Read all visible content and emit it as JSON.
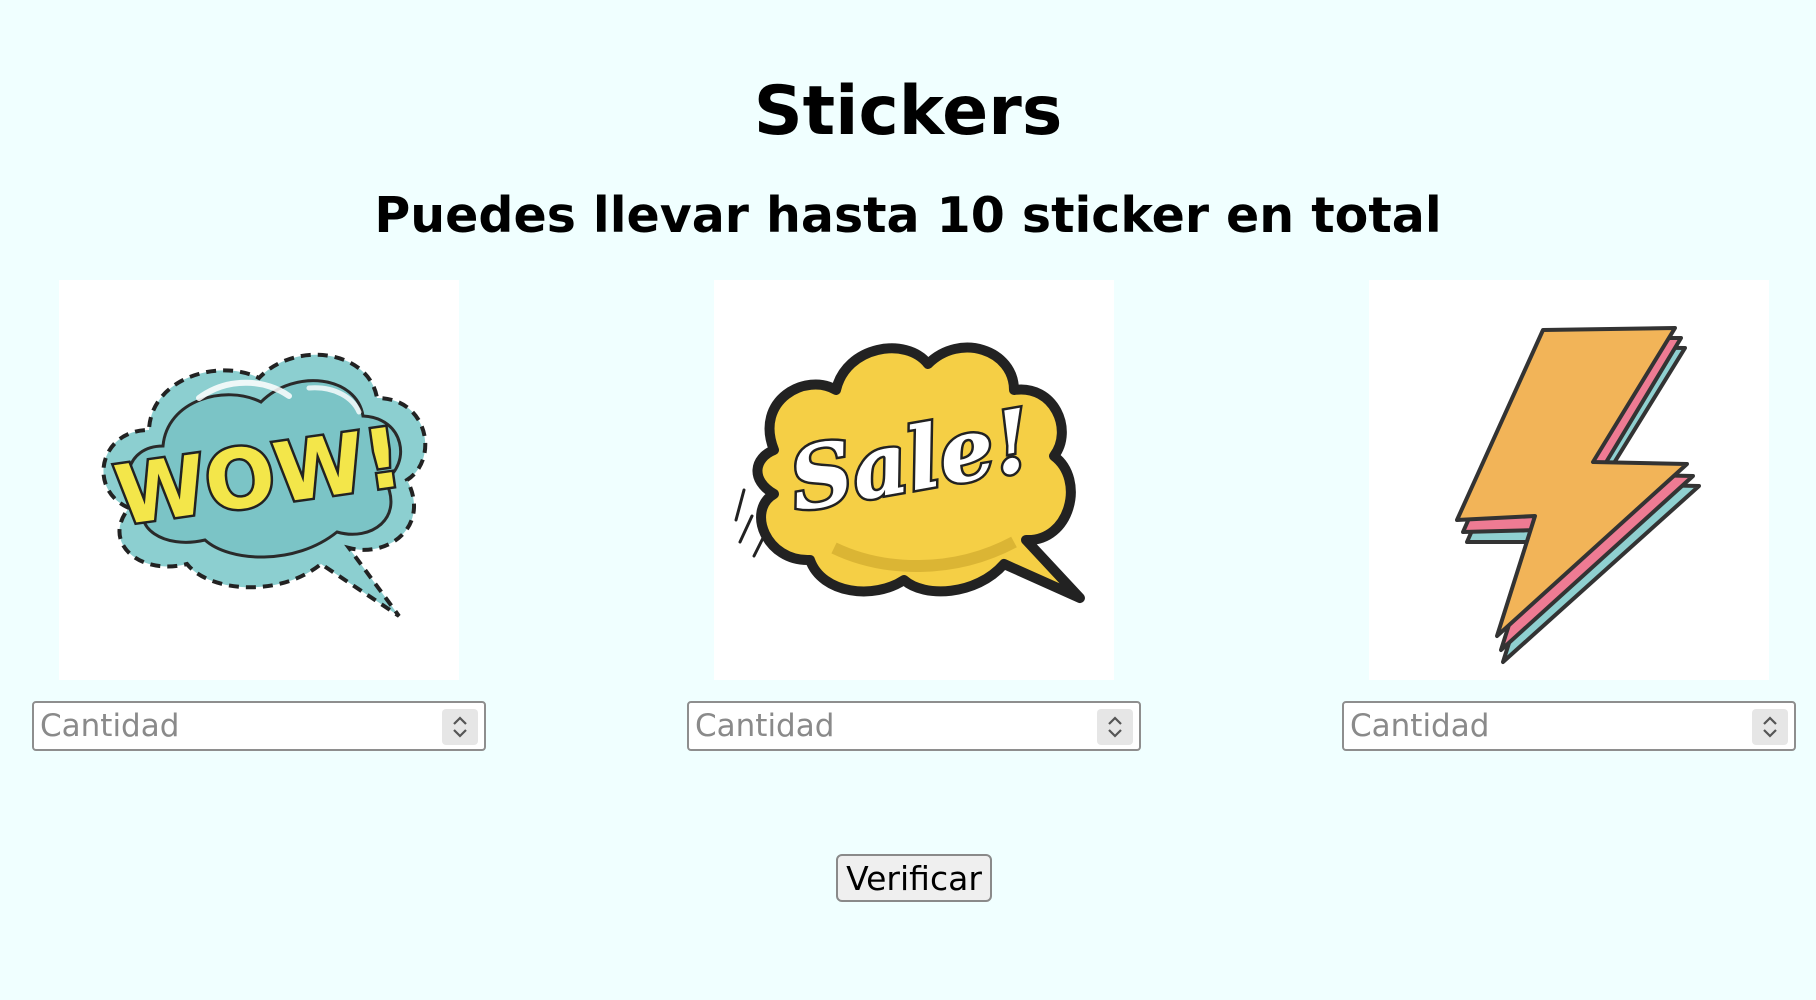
{
  "page": {
    "title": "Stickers",
    "subtitle": "Puedes llevar hasta 10 sticker en total",
    "background_color": "#f0ffff"
  },
  "stickers": [
    {
      "image_icon": "wow-speech-bubble-sticker",
      "image_text": "WOW!",
      "quantity_placeholder": "Cantidad",
      "quantity_value": ""
    },
    {
      "image_icon": "sale-cloud-sticker",
      "image_text": "Sale!",
      "quantity_placeholder": "Cantidad",
      "quantity_value": ""
    },
    {
      "image_icon": "lightning-bolt-sticker",
      "quantity_placeholder": "Cantidad",
      "quantity_value": ""
    }
  ],
  "verify_button": {
    "label": "Verificar"
  }
}
